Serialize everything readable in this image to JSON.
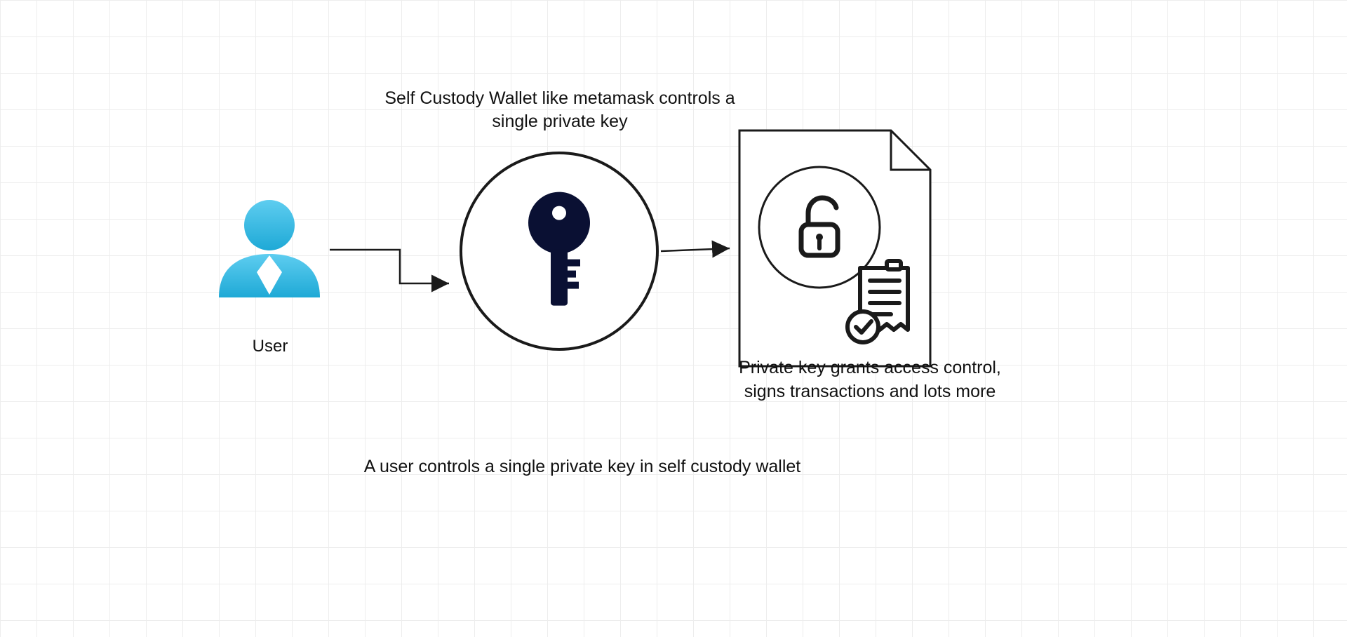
{
  "diagram": {
    "nodes": {
      "user": {
        "label": "User",
        "icon": "user-icon"
      },
      "wallet": {
        "label": "Self Custody Wallet like metamask controls a single private key",
        "icon": "key-icon"
      },
      "document": {
        "label": "Private key grants access control, signs transactions and lots more",
        "icon": "document-access-icon"
      }
    },
    "caption": "A user controls a single private key in self custody wallet",
    "edges": [
      {
        "from": "user",
        "to": "wallet"
      },
      {
        "from": "wallet",
        "to": "document"
      }
    ],
    "colors": {
      "user_fill": "#3cbce6",
      "key_fill": "#0a1033",
      "stroke": "#1a1a1a"
    }
  }
}
